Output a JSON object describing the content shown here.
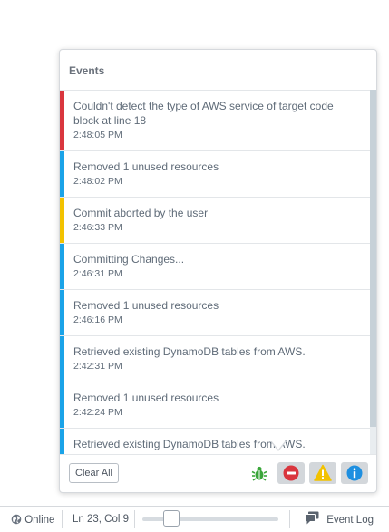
{
  "panel": {
    "title": "Events",
    "clear_label": "Clear All"
  },
  "events": [
    {
      "message": "Couldn't detect the type of AWS service of target code block at line 18",
      "time": "2:48:05 PM",
      "level": "error"
    },
    {
      "message": "Removed 1 unused resources",
      "time": "2:48:02 PM",
      "level": "info"
    },
    {
      "message": "Commit aborted by the user",
      "time": "2:46:33 PM",
      "level": "warning"
    },
    {
      "message": "Committing Changes...",
      "time": "2:46:31 PM",
      "level": "info"
    },
    {
      "message": "Removed 1 unused resources",
      "time": "2:46:16 PM",
      "level": "info"
    },
    {
      "message": "Retrieved existing DynamoDB tables from AWS.",
      "time": "2:42:31 PM",
      "level": "info"
    },
    {
      "message": "Removed 1 unused resources",
      "time": "2:42:24 PM",
      "level": "info"
    },
    {
      "message": "Retrieved existing DynamoDB tables from AWS.",
      "time": "",
      "level": "info"
    }
  ],
  "level_colors": {
    "error": "#d9363e",
    "warning": "#f2c200",
    "info": "#1aa3e8"
  },
  "filters": [
    {
      "icon": "bug-icon",
      "active": false
    },
    {
      "icon": "error-icon",
      "active": true
    },
    {
      "icon": "warning-icon",
      "active": true
    },
    {
      "icon": "info-icon",
      "active": true
    }
  ],
  "statusbar": {
    "online_label": "Online",
    "cursor_label": "Ln 23, Col 9",
    "event_log_label": "Event Log"
  }
}
